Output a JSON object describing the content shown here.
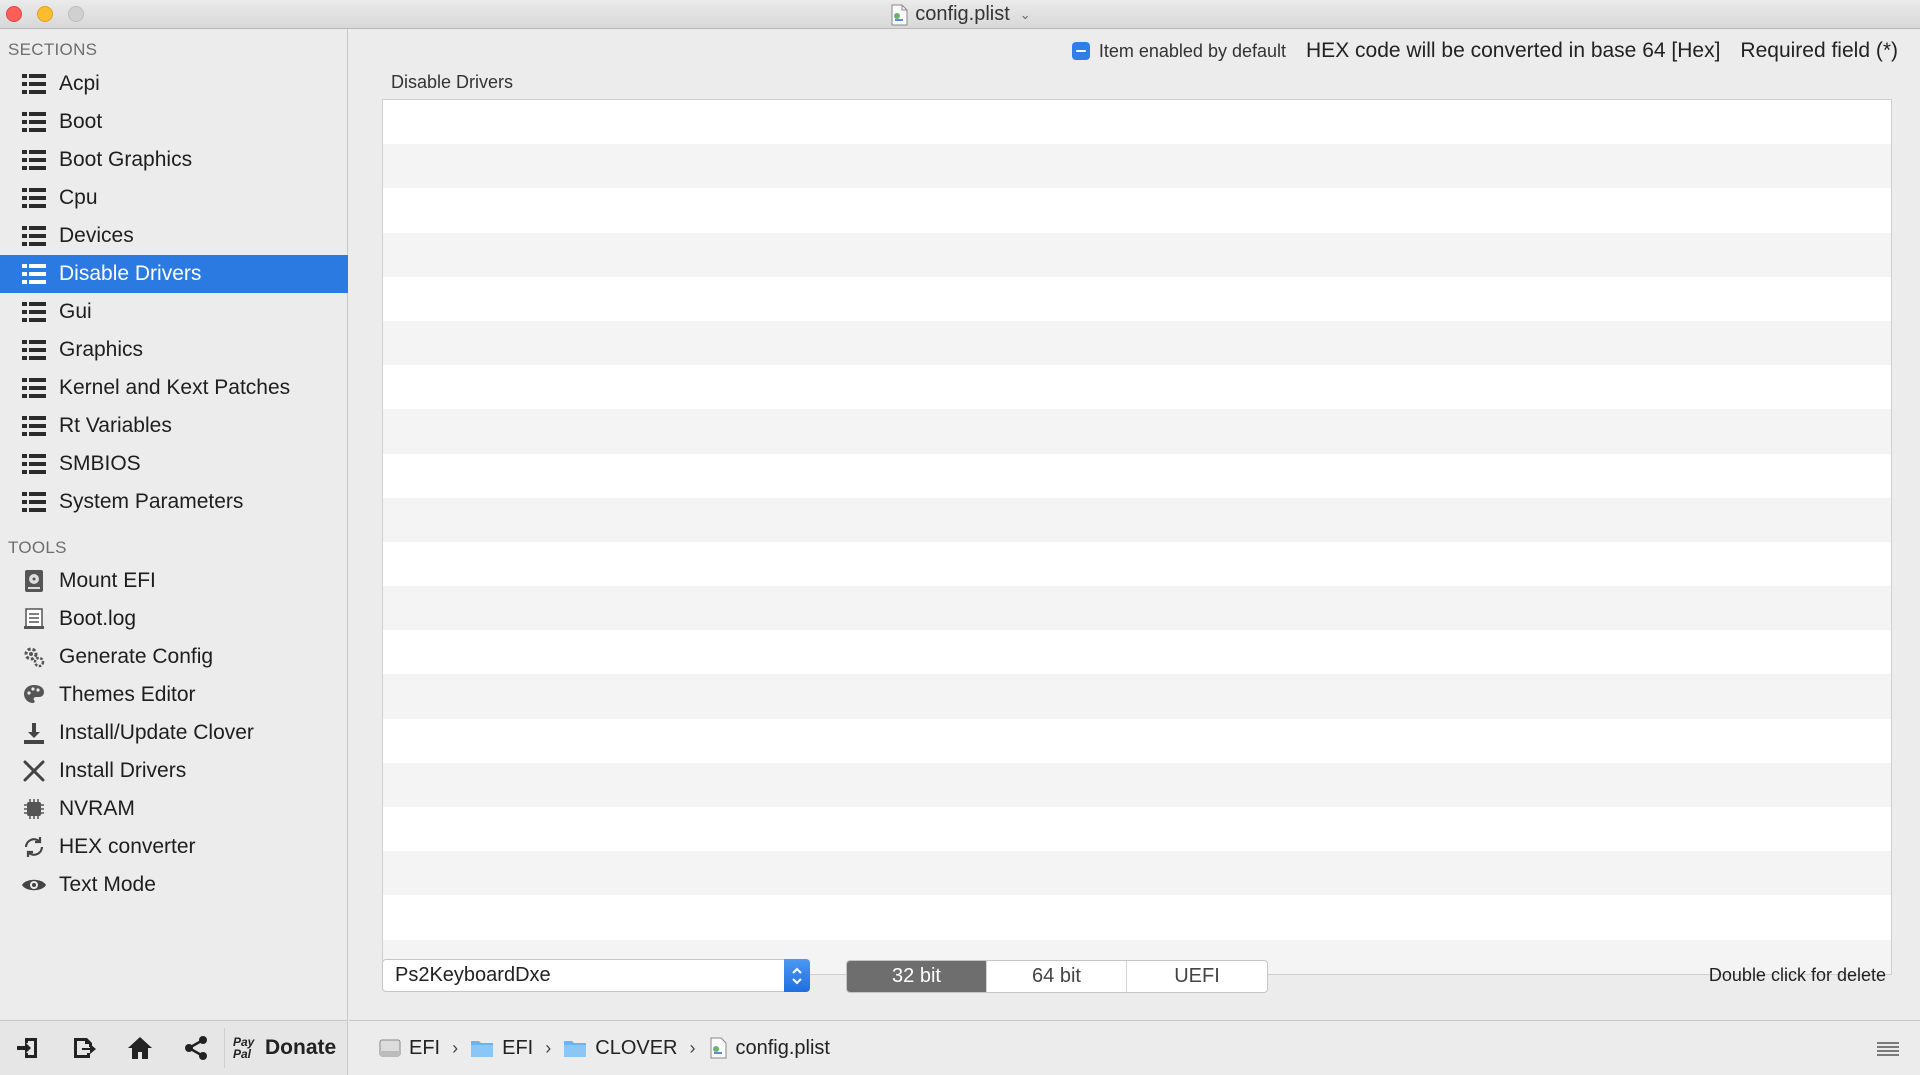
{
  "window": {
    "title": "config.plist"
  },
  "sidebar": {
    "sections_heading": "SECTIONS",
    "sections": [
      {
        "label": "Acpi",
        "icon": "list-icon"
      },
      {
        "label": "Boot",
        "icon": "list-icon"
      },
      {
        "label": "Boot Graphics",
        "icon": "list-icon"
      },
      {
        "label": "Cpu",
        "icon": "list-icon"
      },
      {
        "label": "Devices",
        "icon": "list-icon"
      },
      {
        "label": "Disable Drivers",
        "icon": "list-icon",
        "selected": true
      },
      {
        "label": "Gui",
        "icon": "list-icon"
      },
      {
        "label": "Graphics",
        "icon": "list-icon"
      },
      {
        "label": "Kernel and Kext Patches",
        "icon": "list-icon"
      },
      {
        "label": "Rt Variables",
        "icon": "list-icon"
      },
      {
        "label": "SMBIOS",
        "icon": "list-icon"
      },
      {
        "label": "System Parameters",
        "icon": "list-icon"
      }
    ],
    "tools_heading": "TOOLS",
    "tools": [
      {
        "label": "Mount EFI",
        "icon": "disk-icon"
      },
      {
        "label": "Boot.log",
        "icon": "log-icon"
      },
      {
        "label": "Generate Config",
        "icon": "gears-icon"
      },
      {
        "label": "Themes Editor",
        "icon": "palette-icon"
      },
      {
        "label": "Install/Update Clover",
        "icon": "download-icon"
      },
      {
        "label": "Install Drivers",
        "icon": "tools-icon"
      },
      {
        "label": "NVRAM",
        "icon": "chip-icon"
      },
      {
        "label": "HEX converter",
        "icon": "refresh-icon"
      },
      {
        "label": "Text Mode",
        "icon": "eye-icon"
      }
    ],
    "toolbar": {
      "donate_label": "Donate",
      "paypal_text": "Pay Pal"
    }
  },
  "main": {
    "legend": {
      "enabled_label": "Item enabled by default",
      "hex_note": "HEX code will be converted in base 64 [Hex]",
      "required_note": "Required field (*)"
    },
    "section_title": "Disable Drivers",
    "driver_select": {
      "value": "Ps2KeyboardDxe"
    },
    "arch_options": [
      {
        "label": "32 bit",
        "selected": true
      },
      {
        "label": "64 bit",
        "selected": false
      },
      {
        "label": "UEFI",
        "selected": false
      }
    ],
    "hint": "Double click for delete"
  },
  "pathbar": {
    "crumbs": [
      {
        "label": "EFI",
        "icon": "drive-icon"
      },
      {
        "label": "EFI",
        "icon": "folder-icon"
      },
      {
        "label": "CLOVER",
        "icon": "folder-icon"
      },
      {
        "label": "config.plist",
        "icon": "plist-icon"
      }
    ],
    "separator": "›"
  },
  "colors": {
    "accent": "#2a7ae2",
    "selected_segment": "#6e6e6e"
  }
}
